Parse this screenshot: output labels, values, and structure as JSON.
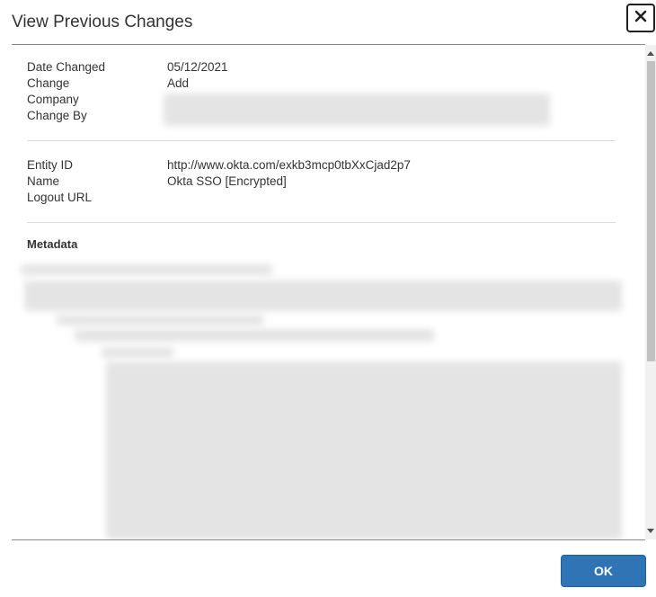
{
  "dialog": {
    "title": "View Previous Changes",
    "close_icon": "close-icon"
  },
  "change_info": [
    {
      "label": "Date Changed",
      "value": "05/12/2021"
    },
    {
      "label": "Change",
      "value": "Add"
    },
    {
      "label": "Company",
      "value": ""
    },
    {
      "label": "Change By",
      "value": ""
    }
  ],
  "entity_info": [
    {
      "label": "Entity ID",
      "value": "http://www.okta.com/exkb3mcp0tbXxCjad2p7"
    },
    {
      "label": "Name",
      "value": "Okta SSO [Encrypted]"
    },
    {
      "label": "Logout URL",
      "value": ""
    }
  ],
  "metadata": {
    "heading": "Metadata"
  },
  "footer": {
    "ok_label": "OK"
  },
  "colors": {
    "primary_button": "#2f75b5",
    "text": "#333333",
    "divider": "#dcdcdc"
  }
}
